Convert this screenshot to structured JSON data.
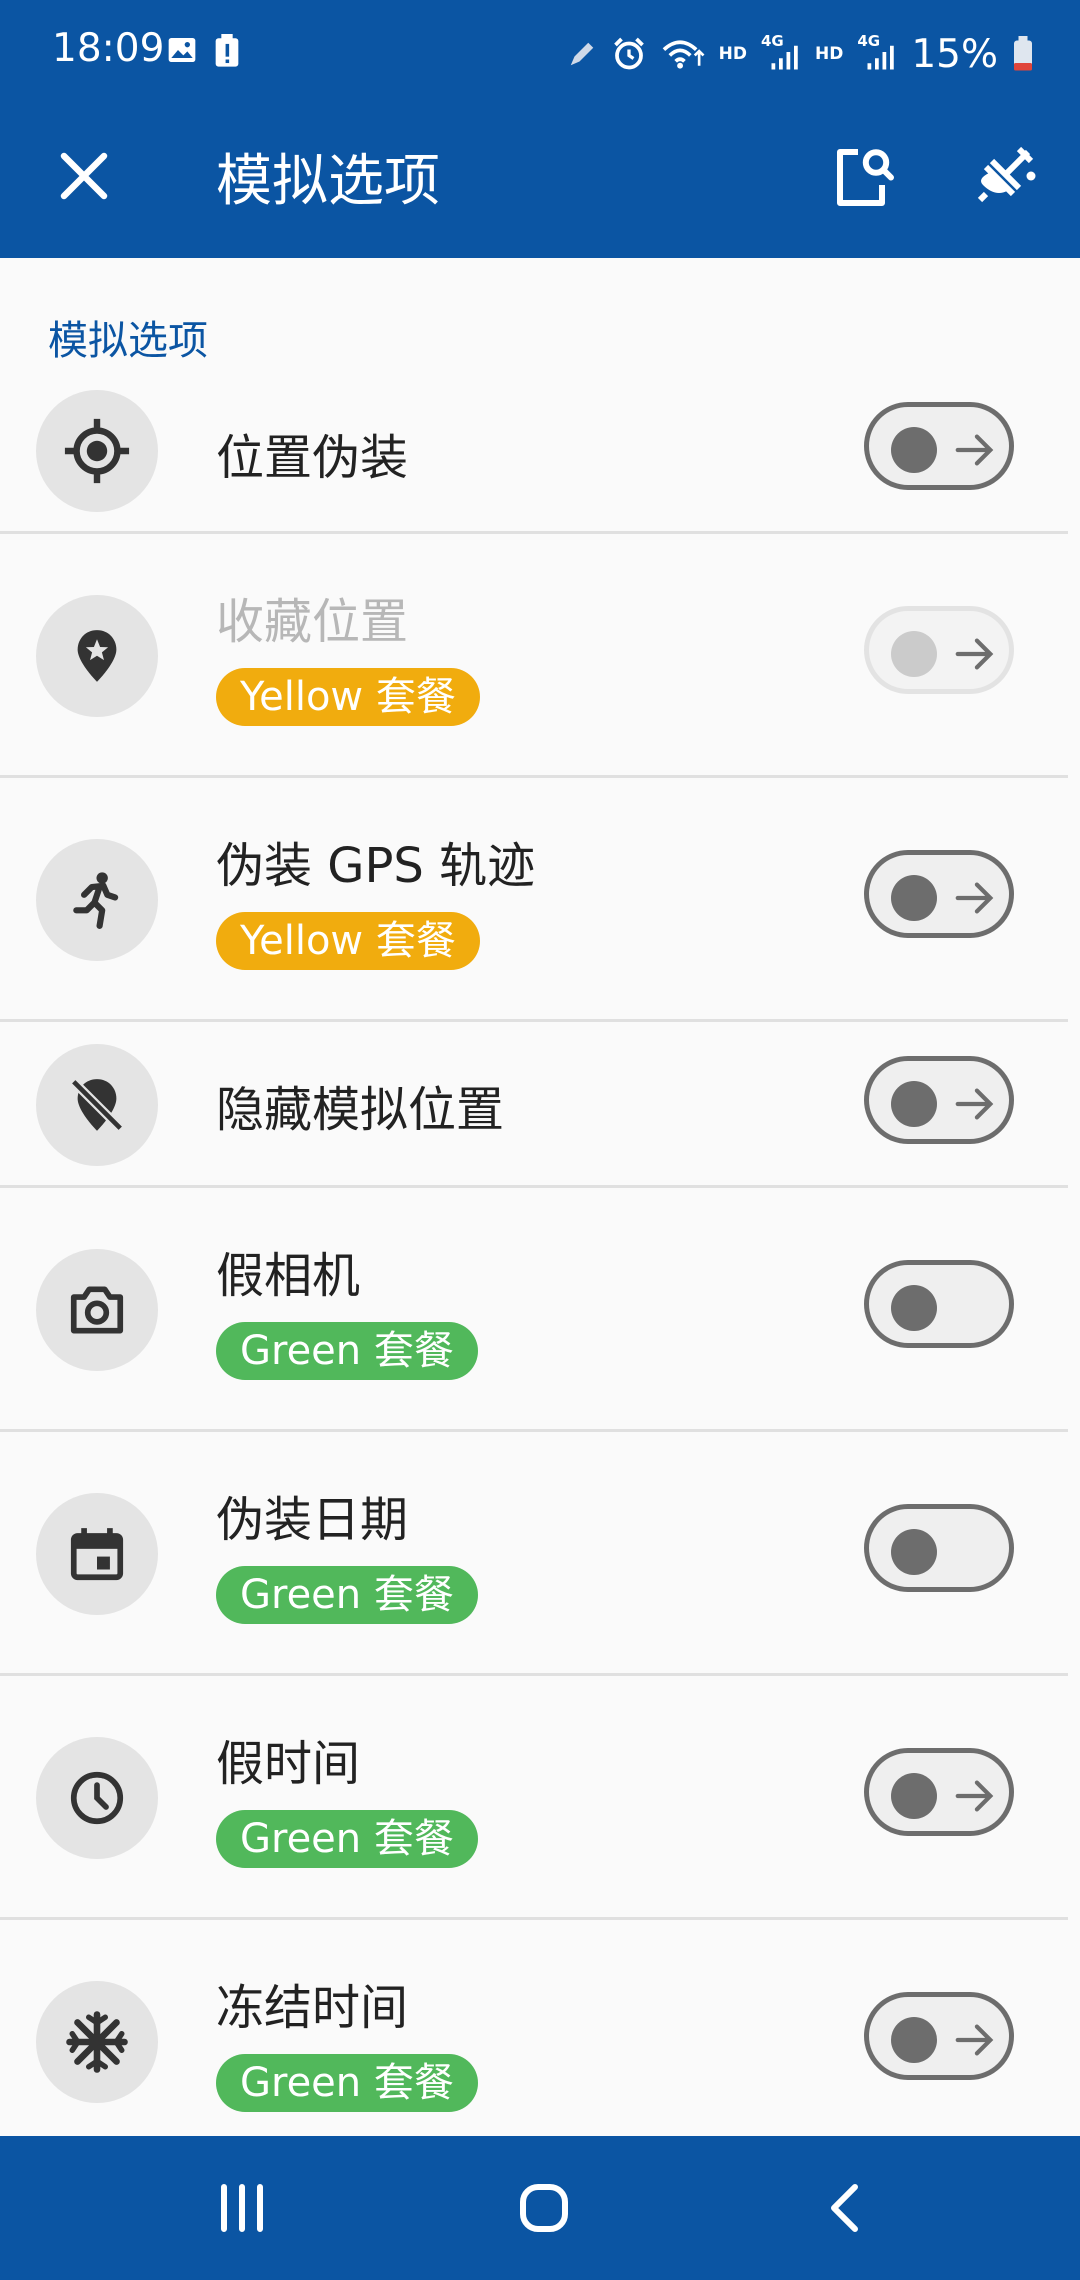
{
  "status_bar": {
    "time": "18:09",
    "battery": "15%",
    "hd1": "HD",
    "hd2": "HD",
    "net1": "4G",
    "net2": "4G"
  },
  "app_bar": {
    "title": "模拟选项"
  },
  "section": {
    "label": "模拟选项"
  },
  "items": [
    {
      "label": "位置伪装",
      "icon": "crosshair-icon",
      "badge": null,
      "enabled": true,
      "arrow": true
    },
    {
      "label": "收藏位置",
      "icon": "favorite-location-icon",
      "badge": "Yellow 套餐",
      "badge_color": "#f1ac0e",
      "enabled": false,
      "arrow": true
    },
    {
      "label": "伪装 GPS 轨迹",
      "icon": "running-person-icon",
      "badge": "Yellow 套餐",
      "badge_color": "#f1ac0e",
      "enabled": true,
      "arrow": true
    },
    {
      "label": "隐藏模拟位置",
      "icon": "location-off-icon",
      "badge": null,
      "enabled": true,
      "arrow": true
    },
    {
      "label": "假相机",
      "icon": "camera-icon",
      "badge": "Green 套餐",
      "badge_color": "#51b85b",
      "enabled": true,
      "arrow": false
    },
    {
      "label": "伪装日期",
      "icon": "calendar-icon",
      "badge": "Green 套餐",
      "badge_color": "#51b85b",
      "enabled": true,
      "arrow": false
    },
    {
      "label": "假时间",
      "icon": "clock-icon",
      "badge": "Green 套餐",
      "badge_color": "#51b85b",
      "enabled": true,
      "arrow": true
    },
    {
      "label": "冻结时间",
      "icon": "freeze-icon",
      "badge": "Green 套餐",
      "badge_color": "#51b85b",
      "enabled": true,
      "arrow": true
    }
  ],
  "colors": {
    "primary": "#0b55a3",
    "yellow_badge": "#f1ac0e",
    "green_badge": "#51b85b"
  }
}
